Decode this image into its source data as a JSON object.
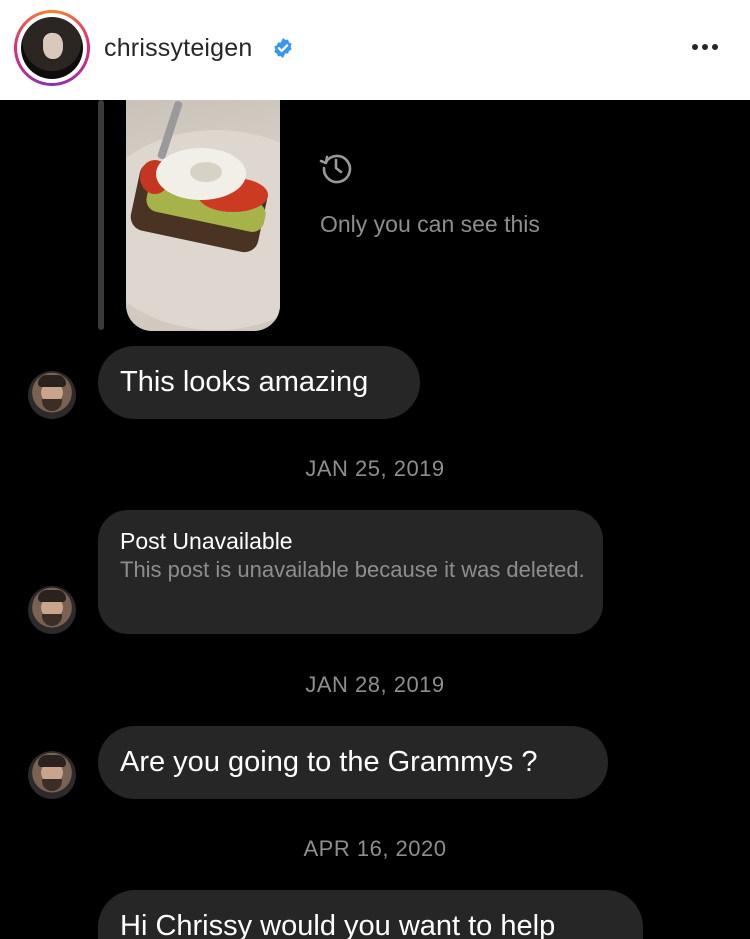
{
  "header": {
    "username": "chrissyteigen",
    "verified": true,
    "more_icon": "more-horizontal-icon"
  },
  "story": {
    "notice": "Only you can see this",
    "notice_icon": "history-icon"
  },
  "messages": [
    {
      "type": "text",
      "text": "This looks amazing"
    },
    {
      "type": "date",
      "text": "JAN 25, 2019"
    },
    {
      "type": "post",
      "title": "Post Unavailable",
      "subtitle": "This post is unavailable because it was deleted."
    },
    {
      "type": "date",
      "text": "JAN 28, 2019"
    },
    {
      "type": "text",
      "text": "Are you going to the Grammys ?"
    },
    {
      "type": "date",
      "text": "APR 16, 2020"
    },
    {
      "type": "text",
      "text": "Hi Chrissy would you want to help"
    }
  ],
  "colors": {
    "background": "#000000",
    "bubble": "#262626",
    "muted_text": "#8e8e8e",
    "verified_blue": "#3897f0"
  }
}
